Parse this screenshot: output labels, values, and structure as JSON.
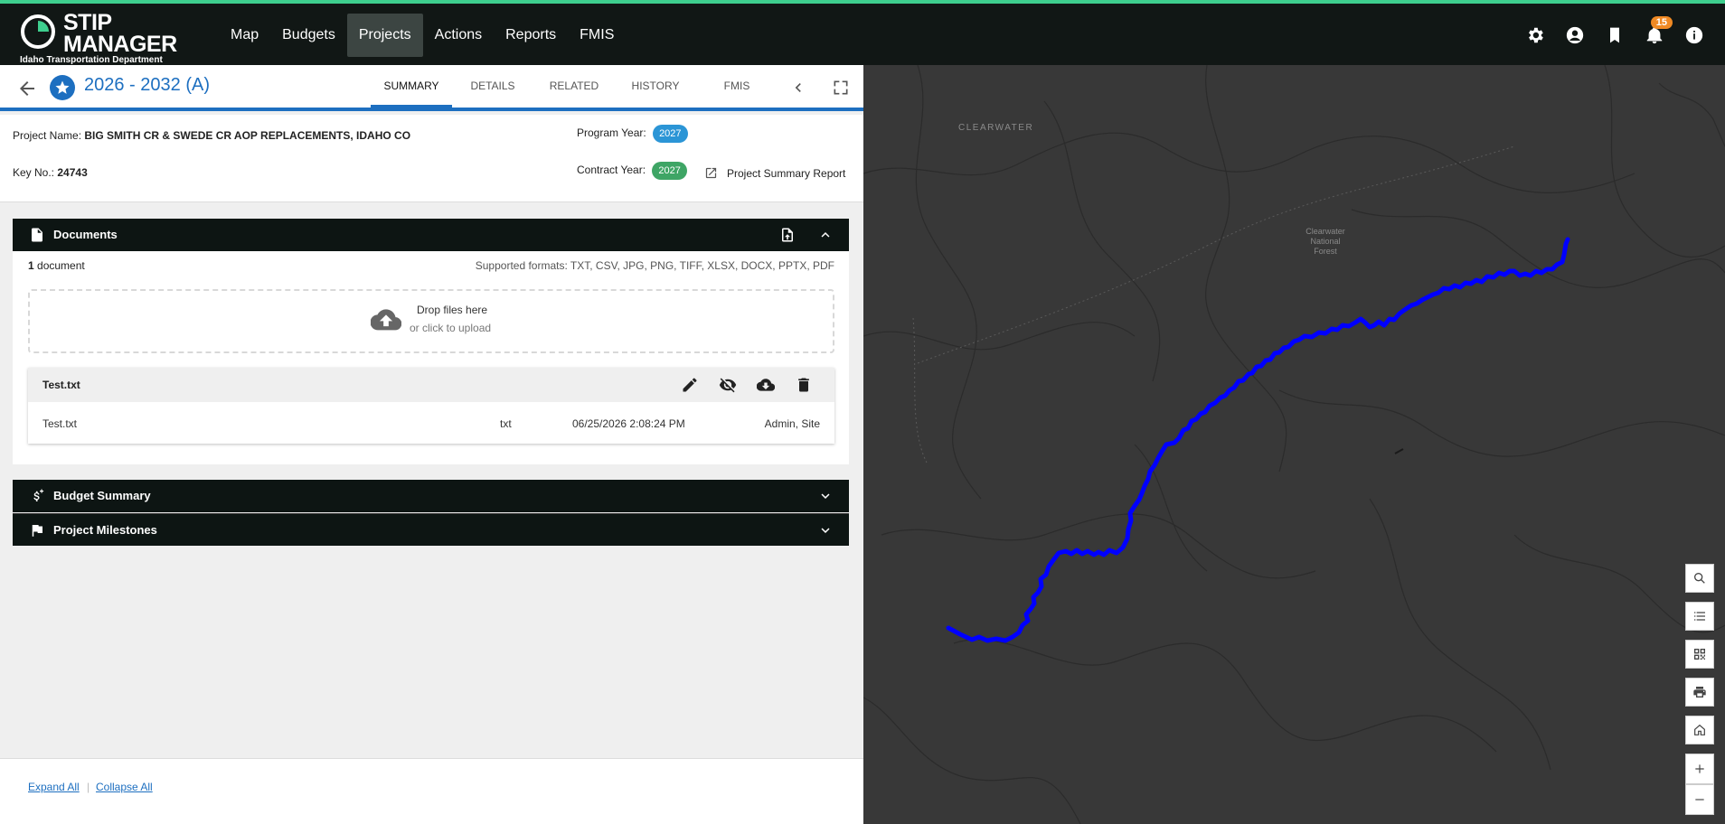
{
  "app": {
    "logo_line1": "STIP",
    "logo_line2": "MANAGER",
    "logo_sub": "Idaho Transportation Department"
  },
  "nav": {
    "items": [
      "Map",
      "Budgets",
      "Projects",
      "Actions",
      "Reports",
      "FMIS"
    ],
    "active": "Projects"
  },
  "toolbar": {
    "icons": [
      "settings-icon",
      "account-icon",
      "bookmark-icon",
      "notifications-icon",
      "info-icon"
    ],
    "notification_count": "15"
  },
  "project": {
    "title": "2026 - 2032 (A)",
    "tabs": [
      "SUMMARY",
      "DETAILS",
      "RELATED",
      "HISTORY",
      "FMIS"
    ],
    "active_tab": "SUMMARY",
    "name_label": "Project Name:",
    "name": "BIG SMITH CR & SWEDE CR AOP REPLACEMENTS, IDAHO CO",
    "key_label": "Key No.:",
    "key": "24743",
    "program_year_label": "Program Year:",
    "program_year": "2027",
    "contract_year_label": "Contract Year:",
    "contract_year": "2027",
    "summary_report": "Project Summary Report"
  },
  "documents": {
    "title": "Documents",
    "count": "1",
    "count_label": "document",
    "formats": "Supported formats: TXT, CSV, JPG, PNG, TIFF, XLSX, DOCX, PPTX, PDF",
    "drop_line1": "Drop files here",
    "drop_line2": "or click to upload",
    "file": {
      "header": "Test.txt",
      "name": "Test.txt",
      "type": "txt",
      "date": "06/25/2026 2:08:24 PM",
      "user": "Admin, Site"
    }
  },
  "panels": {
    "budget": "Budget Summary",
    "milestones": "Project Milestones"
  },
  "footer": {
    "expand": "Expand All",
    "collapse": "Collapse All",
    "separator": "|"
  },
  "map": {
    "label_region": "CLEARWATER",
    "label_forest_1": "Clearwater",
    "label_forest_2": "National",
    "label_forest_3": "Forest",
    "route_color": "#0000ff",
    "tools": [
      "search-icon",
      "legend-icon",
      "qr-code-icon",
      "print-icon",
      "home-icon",
      "zoom-in-icon",
      "zoom-out-icon"
    ]
  },
  "colors": {
    "accent": "#1d6fc0",
    "topbar": "#111715",
    "topbar_stripe": "#3ecf8e",
    "program_pill": "#2b95d6",
    "contract_pill": "#3ea565"
  }
}
